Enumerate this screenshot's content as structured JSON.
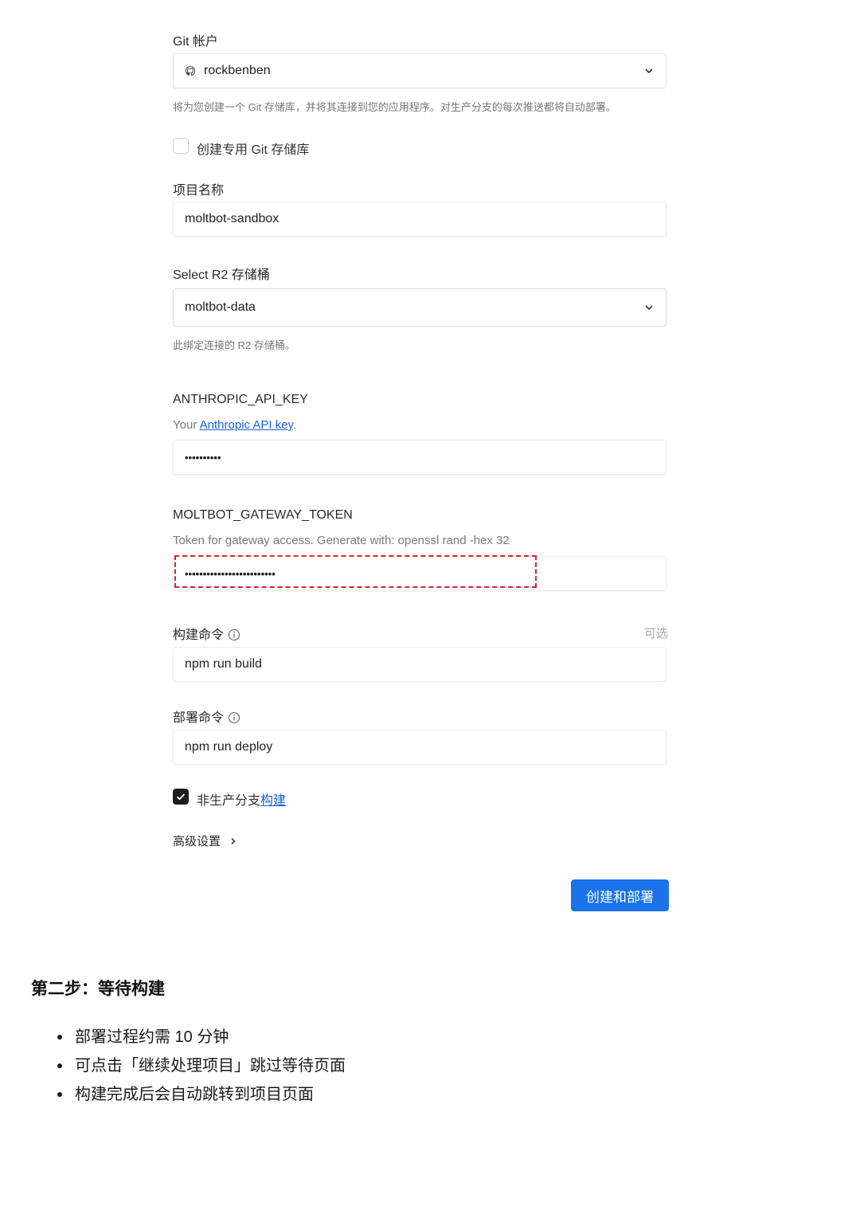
{
  "form": {
    "git_account": {
      "label": "Git 帐户",
      "value": "rockbenben",
      "hint": "将为您创建一个 Git 存储库，并将其连接到您的应用程序。对生产分支的每次推送都将自动部署。"
    },
    "private_repo_checkbox": {
      "label": "创建专用 Git 存储库",
      "checked": false
    },
    "project_name": {
      "label": "项目名称",
      "value": "moltbot-sandbox"
    },
    "r2_bucket": {
      "label": "Select R2 存储桶",
      "value": "moltbot-data",
      "hint": "此绑定连接的 R2 存储桶。"
    },
    "anthropic_key": {
      "label": "ANTHROPIC_API_KEY",
      "desc_prefix": "Your ",
      "desc_link": "Anthropic API key",
      "desc_suffix": ".",
      "value": "••••••••••"
    },
    "gateway_token": {
      "label": "MOLTBOT_GATEWAY_TOKEN",
      "desc": "Token for gateway access. Generate with: openssl rand -hex 32",
      "value": "•••••••••••••••••••••••••"
    },
    "build_command": {
      "label": "构建命令",
      "optional": "可选",
      "value": "npm run build"
    },
    "deploy_command": {
      "label": "部署命令",
      "value": "npm run deploy"
    },
    "non_prod_build": {
      "label_prefix": "非生产分支",
      "label_link": "构建",
      "checked": true
    },
    "advanced_settings": {
      "label": "高级设置"
    },
    "submit_label": "创建和部署"
  },
  "step": {
    "title": "第二步：等待构建",
    "bullets": [
      "部署过程约需 10 分钟",
      "可点击「继续处理项目」跳过等待页面",
      "构建完成后会自动跳转到项目页面"
    ]
  },
  "colors": {
    "accent": "#1a73e8",
    "highlight_border": "#e0202a"
  }
}
